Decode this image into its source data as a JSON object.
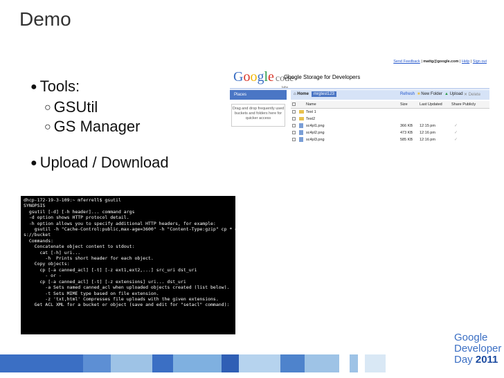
{
  "slide": {
    "title": "Demo",
    "bullets": {
      "tools": "Tools:",
      "gsutil": "GSUtil",
      "gs_manager": "GS Manager",
      "upload_download": "Upload / Download"
    }
  },
  "gs_manager": {
    "top_links": {
      "feedback": "Send Feedback",
      "email": "mattg@google.com",
      "help": "Help",
      "sign_out": "Sign out"
    },
    "logo": {
      "google": "Google",
      "code": "code",
      "labs": "labs"
    },
    "product_title": "Google Storage for Developers",
    "places_label": "Places",
    "places_hint": "Drag and drop frequently used buckets and folders here for quicker access",
    "toolbar": {
      "home": "Home",
      "bucket": "mrgtest123",
      "refresh": "Refresh",
      "new_folder": "New Folder",
      "upload": "Upload",
      "delete": "Delete"
    },
    "columns": {
      "name": "Name",
      "size": "Size",
      "updated": "Last Updated",
      "share": "Share Publicly"
    },
    "rows": [
      {
        "name": "Test 1",
        "size": "",
        "updated": ""
      },
      {
        "name": "Test2",
        "size": "",
        "updated": ""
      },
      {
        "name": "sc4pl1.png",
        "size": "366 KB",
        "updated": "12:15 pm"
      },
      {
        "name": "sc4pl2.png",
        "size": "473 KB",
        "updated": "12:16 pm"
      },
      {
        "name": "sc4pl3.png",
        "size": "585 KB",
        "updated": "12:16 pm"
      }
    ]
  },
  "terminal": {
    "lines": [
      "dhcp-172-19-3-109:~ mferrell$ gsutil",
      "",
      "SYNOPSIS",
      "  gsutil [-d] [-h header]... command args",
      "",
      "  -d option shows HTTP protocol detail.",
      "",
      "  -h option allows you to specify additional HTTP headers, for example:",
      "    gsutil -h \"Cache-Control:public,max-age=3600\" -h \"Content-Type:gzip\" cp * g",
      "s://bucket",
      "",
      "  Commands:",
      "    Concatenate object content to stdout:",
      "      cat [-h] uri...",
      "        -h  Prints short header for each object.",
      "    Copy objects:",
      "      cp [-a canned_acl] [-t] [-z ext1,ext2,...] src_uri dst_uri",
      "        - or -",
      "      cp [-a canned_acl] [-t] [-z extensions] uri... dst_uri",
      "        -a Sets named canned_acl when uploaded objects created (list below).",
      "        -t Sets MIME type based on file extension.",
      "        -z 'txt,html' Compresses file uploads with the given extensions.",
      "    Get ACL XML for a bucket or object (save and edit for \"setacl\" command):"
    ]
  },
  "branding": {
    "line1": "Google",
    "line2": "Developer",
    "line3": "Day",
    "year": "2011"
  },
  "colors": {
    "stripe_blue": "#3b6fc4",
    "stripe_light": "#9ec3e6",
    "stripe_pale": "#d9e8f5"
  }
}
